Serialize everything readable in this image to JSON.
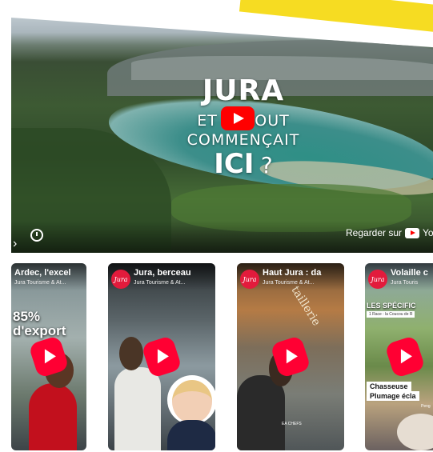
{
  "video": {
    "title_line1": "JURA",
    "title_line2": "ET SI TOUT COMMENÇAIT",
    "title_line3": "ICI",
    "title_q": "?",
    "watch_on": "Regarder sur",
    "watch_on_brand": "YouTube"
  },
  "shorts": [
    {
      "title": "Ardec, l'excel",
      "channel": "Jura Tourisme & At...",
      "overlay": "85%",
      "overlay2": "d'export"
    },
    {
      "title": "Jura, berceau",
      "channel": "Jura Tourisme & At...",
      "badge": "Jura"
    },
    {
      "title": "Haut Jura : da",
      "channel": "Jura Tourisme & At...",
      "badge": "Jura",
      "sign": "taillerie",
      "tag": "EA CHEFS"
    },
    {
      "title": "Volaille c",
      "channel": "Jura Touris",
      "badge": "Jura",
      "overlay": "LES SPÉCIFIC",
      "overlay_sub": "1 Race : la Coucou de R",
      "caption1": "Chasseuse",
      "caption2": "Plumage écla",
      "caption3": "Peng"
    }
  ],
  "colors": {
    "accent_yellow": "#f6dc22",
    "youtube_red": "#ff0000",
    "shorts_red": "#ff0033",
    "jura_red": "#e21b3c"
  }
}
